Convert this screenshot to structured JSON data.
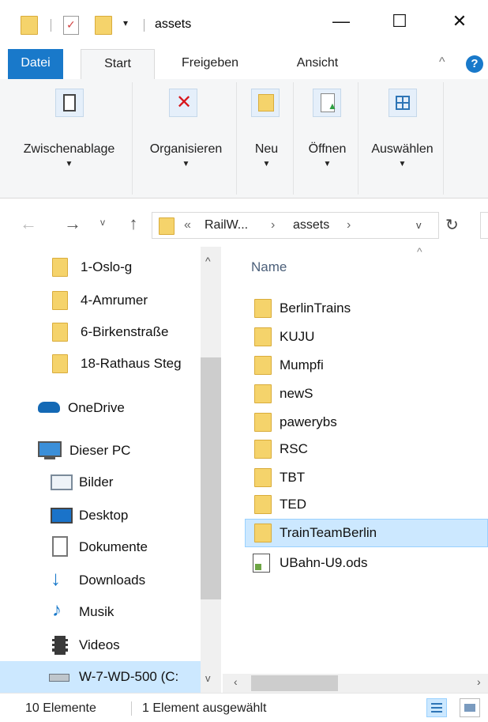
{
  "window": {
    "title": "assets",
    "minimize_glyph": "—",
    "maximize_glyph": "☐",
    "close_glyph": "✕"
  },
  "ribbon_tabs": [
    "Datei",
    "Start",
    "Freigeben",
    "Ansicht"
  ],
  "ribbon_groups": [
    {
      "label": "Zwischenablage",
      "icon": "clipboard-icon"
    },
    {
      "label": "Organisieren",
      "icon": "delete-icon"
    },
    {
      "label": "Neu",
      "icon": "new-folder-icon"
    },
    {
      "label": "Öffnen",
      "icon": "open-icon"
    },
    {
      "label": "Auswählen",
      "icon": "select-icon"
    }
  ],
  "address": {
    "prefix": "«",
    "segments": [
      "RailW...",
      "assets"
    ]
  },
  "nav_pane": {
    "quick": [
      "1-Oslo-g",
      "4-Amrumer",
      "6-Birkenstraße",
      "18-Rathaus Steg"
    ],
    "onedrive": "OneDrive",
    "this_pc": "Dieser PC",
    "pc_items": [
      {
        "label": "Bilder",
        "icon": "pictures-icon"
      },
      {
        "label": "Desktop",
        "icon": "desktop-icon"
      },
      {
        "label": "Dokumente",
        "icon": "documents-icon"
      },
      {
        "label": "Downloads",
        "icon": "downloads-icon"
      },
      {
        "label": "Musik",
        "icon": "music-icon"
      },
      {
        "label": "Videos",
        "icon": "videos-icon"
      },
      {
        "label": "W-7-WD-500 (C:",
        "icon": "drive-icon"
      }
    ]
  },
  "file_list": {
    "column_header": "Name",
    "items": [
      {
        "name": "BerlinTrains",
        "type": "folder"
      },
      {
        "name": "KUJU",
        "type": "folder"
      },
      {
        "name": "Mumpfi",
        "type": "folder"
      },
      {
        "name": "newS",
        "type": "folder"
      },
      {
        "name": "pawerybs",
        "type": "folder"
      },
      {
        "name": "RSC",
        "type": "folder"
      },
      {
        "name": "TBT",
        "type": "folder"
      },
      {
        "name": "TED",
        "type": "folder"
      },
      {
        "name": "TrainTeamBerlin",
        "type": "folder",
        "selected": true
      },
      {
        "name": "UBahn-U9.ods",
        "type": "ods"
      }
    ]
  },
  "status": {
    "count": "10 Elemente",
    "selection": "1 Element ausgewählt"
  },
  "colors": {
    "accent": "#1979ca",
    "selection": "#cce8ff",
    "folder": "#f5d36b"
  }
}
